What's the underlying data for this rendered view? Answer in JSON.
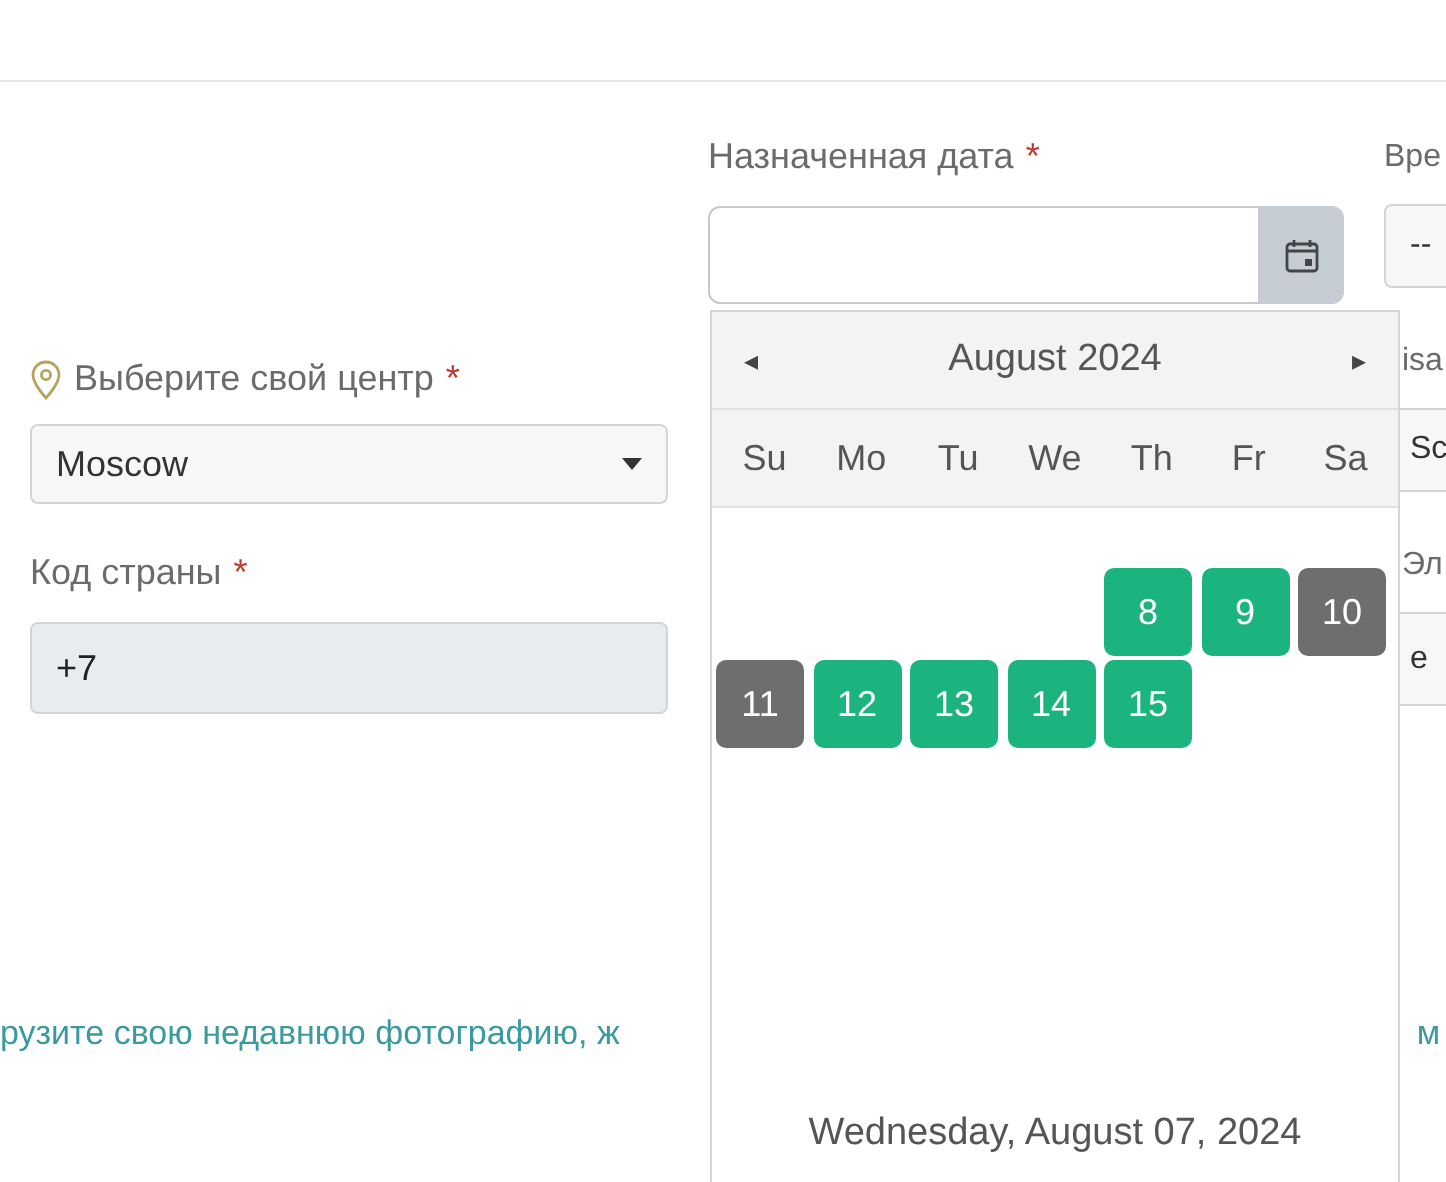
{
  "left_column": {
    "center_label": {
      "text": "Выберите свой центр",
      "required_mark": "*"
    },
    "center_select": {
      "value": "Moscow"
    },
    "country_code_label": {
      "text": "Код страны",
      "required_mark": "*"
    },
    "country_code_field": {
      "value": "+7"
    }
  },
  "date_column": {
    "label": {
      "text": "Назначенная дата",
      "required_mark": "*"
    }
  },
  "right_column": {
    "label_1": "Вре",
    "field_1": "--",
    "label_2": "isa",
    "field_2": "Sc",
    "label_3": "Эл",
    "field_3": "e"
  },
  "photo_note": {
    "left_part": "рузите свою недавнюю фотографию, ж",
    "right_part": "м"
  },
  "datepicker": {
    "prev": "◂",
    "month": "August 2024",
    "next": "▸",
    "weekdays": [
      "Su",
      "Mo",
      "Tu",
      "We",
      "Th",
      "Fr",
      "Sa"
    ],
    "weeks": [
      [
        {
          "kind": "blank"
        },
        {
          "kind": "blank"
        },
        {
          "kind": "blank"
        },
        {
          "kind": "blank"
        },
        {
          "kind": "available",
          "label": "8"
        },
        {
          "kind": "available",
          "label": "9"
        },
        {
          "kind": "unavailable",
          "label": "10"
        }
      ],
      [
        {
          "kind": "unavailable",
          "label": "11"
        },
        {
          "kind": "available",
          "label": "12"
        },
        {
          "kind": "available",
          "label": "13"
        },
        {
          "kind": "available",
          "label": "14"
        },
        {
          "kind": "available",
          "label": "15"
        }
      ]
    ],
    "today": "Wednesday, August 07, 2024"
  }
}
